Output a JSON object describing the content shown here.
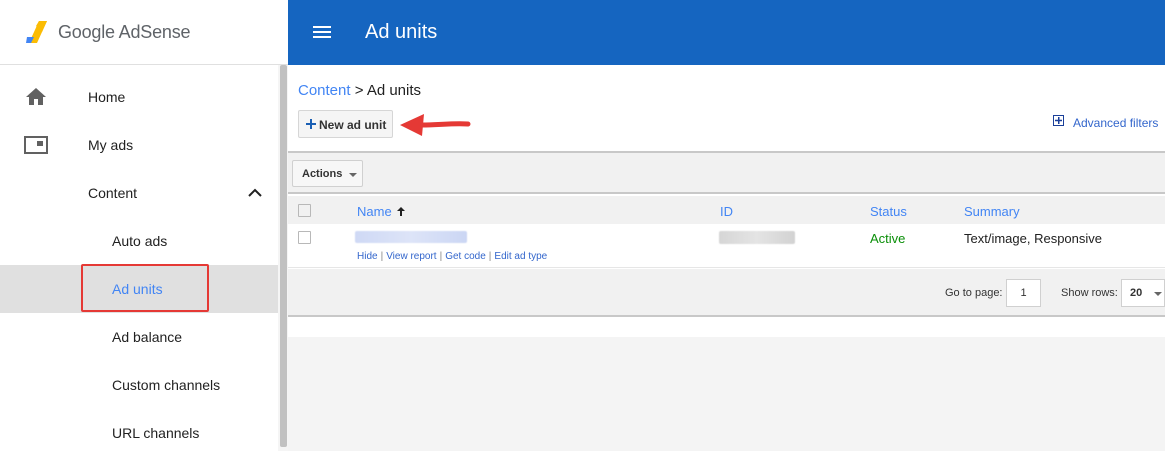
{
  "brand": {
    "name": "Google AdSense"
  },
  "colors": {
    "topbar": "#1565c0",
    "link": "#4285f4",
    "status_active": "#0a8f08",
    "highlight": "#e53935"
  },
  "topbar": {
    "title": "Ad units",
    "menu_icon": "hamburger-menu-icon"
  },
  "sidebar": {
    "items": [
      {
        "label": "Home",
        "icon": "home-icon"
      },
      {
        "label": "My ads",
        "icon": "ads-icon"
      },
      {
        "label": "Content",
        "icon": "chevron-up-icon"
      },
      {
        "label": "Auto ads"
      },
      {
        "label": "Ad units"
      },
      {
        "label": "Ad balance"
      },
      {
        "label": "Custom channels"
      },
      {
        "label": "URL channels"
      }
    ]
  },
  "breadcrumb": {
    "parent": "Content",
    "separator": ">",
    "current": "Ad units"
  },
  "toolbar": {
    "new_ad_unit": "New ad unit",
    "advanced_filters": "Advanced filters",
    "actions": "Actions"
  },
  "table": {
    "columns": {
      "name": "Name",
      "id": "ID",
      "status": "Status",
      "summary": "Summary"
    },
    "rows": [
      {
        "status": "Active",
        "summary": "Text/image, Responsive",
        "links": [
          "Hide",
          "View report",
          "Get code",
          "Edit ad type"
        ]
      }
    ]
  },
  "pagination": {
    "goto_label": "Go to page:",
    "page": "1",
    "rows_label": "Show rows:",
    "rows": "20"
  }
}
